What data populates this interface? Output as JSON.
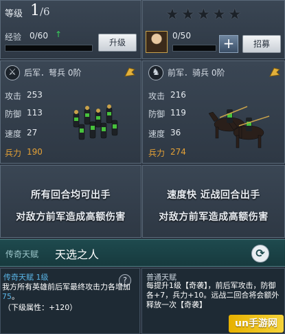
{
  "top_left": {
    "level_label": "等级",
    "level_value": "1",
    "level_max": "/6",
    "exp_label": "经验",
    "exp_value": "0/60",
    "exp_arrow": "↑",
    "upgrade_button": "升级"
  },
  "top_right": {
    "stars": "★★★★★",
    "hero_count": "0/50",
    "plus_button": "+",
    "recruit_button": "招募"
  },
  "troop_left": {
    "title": "后军．弩兵 0阶",
    "icon_glyph": "⚔",
    "stats": [
      {
        "label": "攻击",
        "value": "253"
      },
      {
        "label": "防御",
        "value": "113"
      },
      {
        "label": "速度",
        "value": "27"
      },
      {
        "label": "兵力",
        "value": "190"
      }
    ],
    "desc_line1": "所有回合均可出手",
    "desc_line2": "对敌方前军造成高额伤害"
  },
  "troop_right": {
    "title": "前军．骑兵 0阶",
    "icon_glyph": "♞",
    "stats": [
      {
        "label": "攻击",
        "value": "216"
      },
      {
        "label": "防御",
        "value": "119"
      },
      {
        "label": "速度",
        "value": "36"
      },
      {
        "label": "兵力",
        "value": "274"
      }
    ],
    "desc_line1": "速度快  近战回合出手",
    "desc_line2": "对敌方前军造成高额伤害"
  },
  "talent": {
    "label": "传奇天赋",
    "name": "天选之人",
    "refresh_glyph": "⟳"
  },
  "legend_talent": {
    "title": "传奇天赋  1级",
    "text_a": "我方所有英雄前后军最终攻击力各增加",
    "text_hl": "75",
    "text_b": "。",
    "sub": "（下级属性：+120）",
    "help_glyph": "?"
  },
  "normal_talent": {
    "title": "普通天赋",
    "text": "每提升1级【奇袭】，前后军攻击，防御各+7，兵力+10。远战二回合将会额外释放一次【奇袭】"
  },
  "watermark": "un手游网",
  "colors": {
    "force": "#e6a236",
    "highlight_blue": "#5ab6e8",
    "talent_bar": "#1e4a4e"
  }
}
